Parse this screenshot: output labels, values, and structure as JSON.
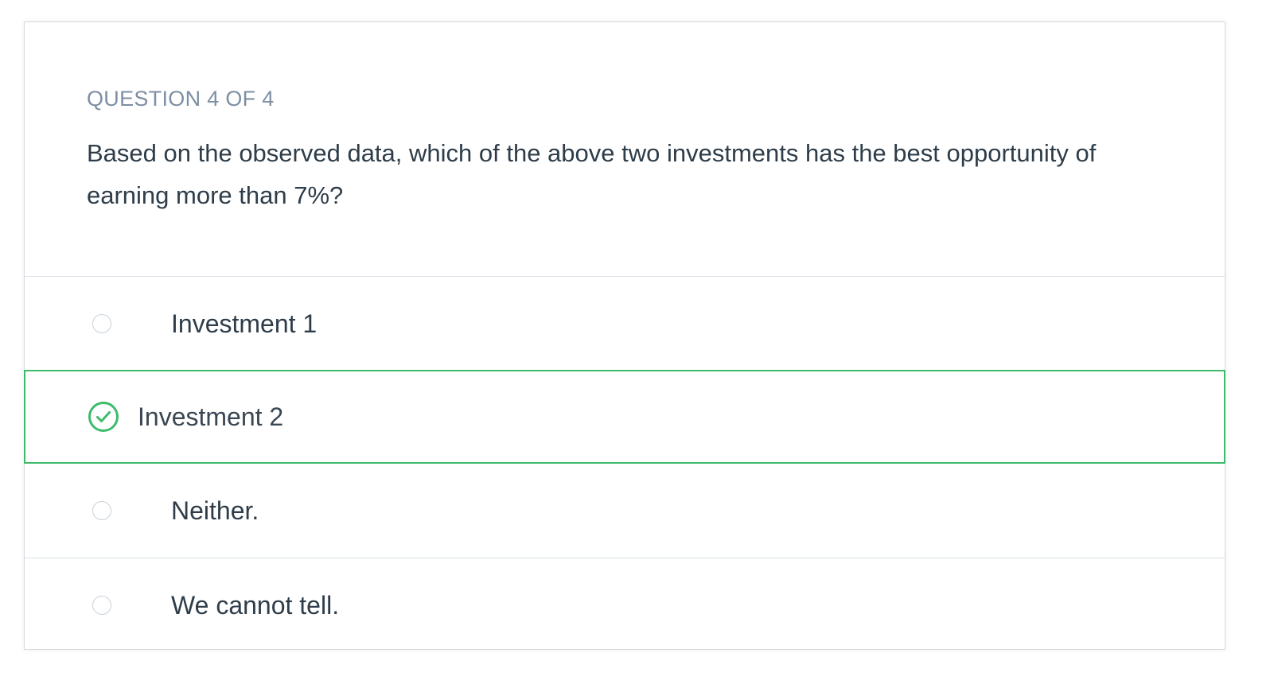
{
  "question": {
    "counter": "QUESTION 4 OF 4",
    "text": "Based on the observed data, which of the above two investments has the best opportunity of earning more than 7%?"
  },
  "options": [
    {
      "label": "Investment 1",
      "selected": false
    },
    {
      "label": "Investment 2",
      "selected": true
    },
    {
      "label": "Neither.",
      "selected": false
    },
    {
      "label": "We cannot tell.",
      "selected": false
    }
  ],
  "colors": {
    "correct": "#3dbb6b",
    "counter": "#7d8fa3",
    "text": "#2e3d49",
    "divider": "#dbe2e8"
  },
  "icons": {
    "selected_option": "check-circle-icon",
    "unselected_option": "radio-empty-icon"
  }
}
